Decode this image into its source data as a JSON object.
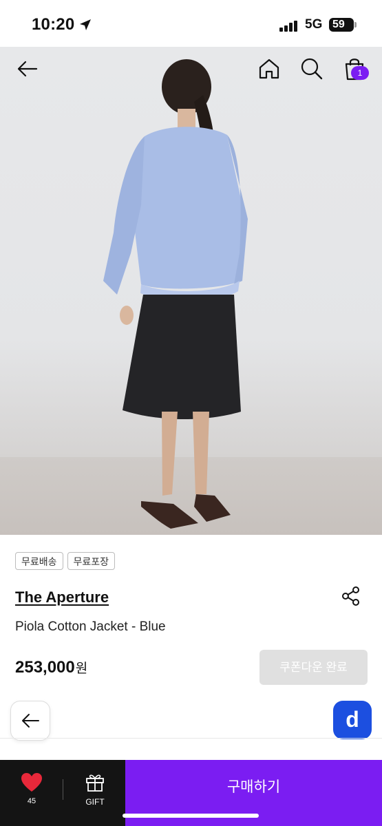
{
  "status_bar": {
    "time": "10:20",
    "network": "5G",
    "battery": "59"
  },
  "nav": {
    "back_icon": "arrow-left-icon",
    "home_icon": "home-icon",
    "search_icon": "search-icon",
    "cart_icon": "shopping-bag-icon",
    "cart_count": "1"
  },
  "gallery": {
    "current_index": 1,
    "indicator_fill": 0.21
  },
  "tags": [
    "무료배송",
    "무료포장"
  ],
  "product": {
    "brand": "The Aperture",
    "name": "Piola Cotton Jacket - Blue",
    "price": "253,000",
    "price_unit": "원",
    "coupon_label": "쿠폰다운 완료"
  },
  "floating": {
    "d_label": "d"
  },
  "bottom_bar": {
    "like_count": "45",
    "gift_label": "GIFT",
    "buy_label": "구매하기"
  },
  "colors": {
    "accent": "#7b1df2",
    "dark": "#141414",
    "d_badge": "#1c4fe0"
  }
}
